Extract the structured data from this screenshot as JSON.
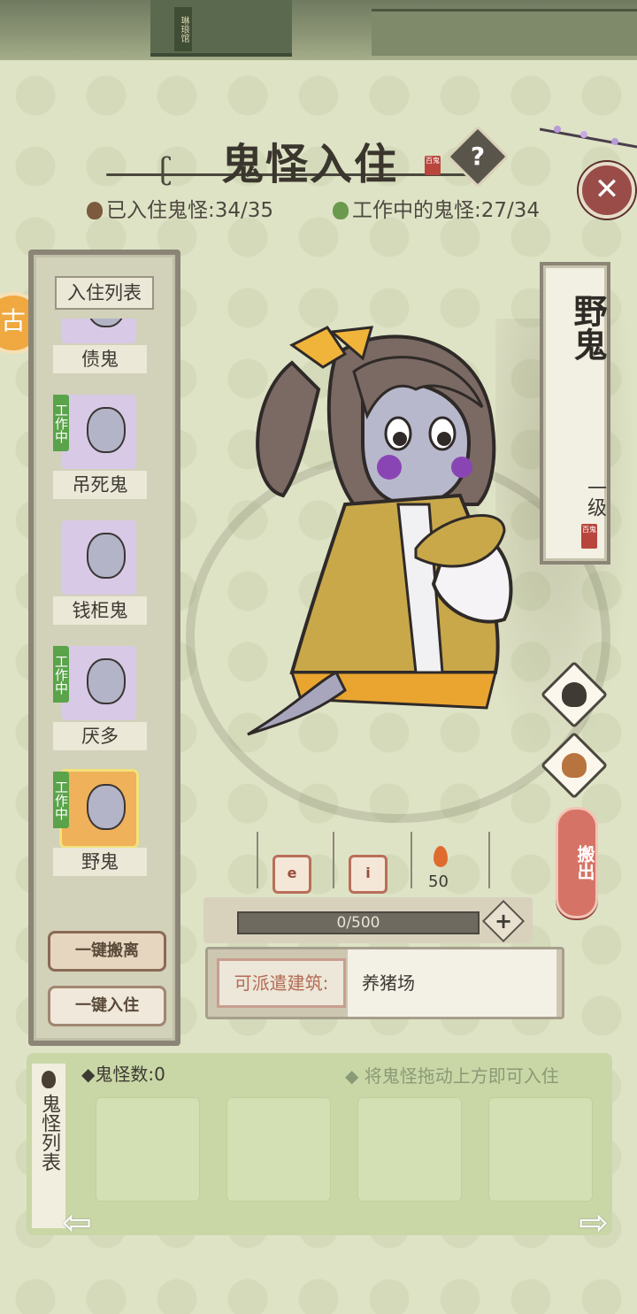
{
  "header": {
    "title": "鬼怪入住",
    "title_stamp": "百鬼",
    "help_label": "?",
    "close_label": "✕",
    "resident_stat": "已入住鬼怪:34/35",
    "working_stat": "工作中的鬼怪:27/34"
  },
  "top_scene": {
    "sign": "琳琅馆"
  },
  "side_badge": "古",
  "resident_list": {
    "title": "入住列表",
    "items": [
      {
        "name": "债鬼",
        "working": false
      },
      {
        "name": "吊死鬼",
        "working": true,
        "tag": "工作中"
      },
      {
        "name": "钱柜鬼",
        "working": false
      },
      {
        "name": "厌多",
        "working": true,
        "tag": "工作中"
      },
      {
        "name": "野鬼",
        "working": true,
        "tag": "工作中",
        "selected": true
      }
    ],
    "evict_all_label": "一键搬离",
    "assign_all_label": "一键入住"
  },
  "selected_ghost": {
    "name": "野鬼",
    "level": "一级",
    "stamp": "百鬼",
    "stat_icon_1": "e",
    "stat_icon_2": "i",
    "flame_value": "50",
    "exp_text": "0/500",
    "move_out_label": "搬出",
    "plus_label": "+",
    "dispatch_label": "可派遣建筑:",
    "dispatch_value": "养猪场"
  },
  "ghost_tray": {
    "label": "鬼怪列表",
    "count": "鬼怪数:0",
    "hint": "将鬼怪拖动上方即可入住",
    "slots": 4,
    "prev_arrow": "⇦",
    "next_arrow": "⇨"
  },
  "colors": {
    "panel_bg": "#dfe3c6",
    "work_tag": "#5aa34a",
    "close_btn": "#9a4c48",
    "move_out_btn": "#d57466",
    "tray_bg": "#c9d7a6"
  }
}
